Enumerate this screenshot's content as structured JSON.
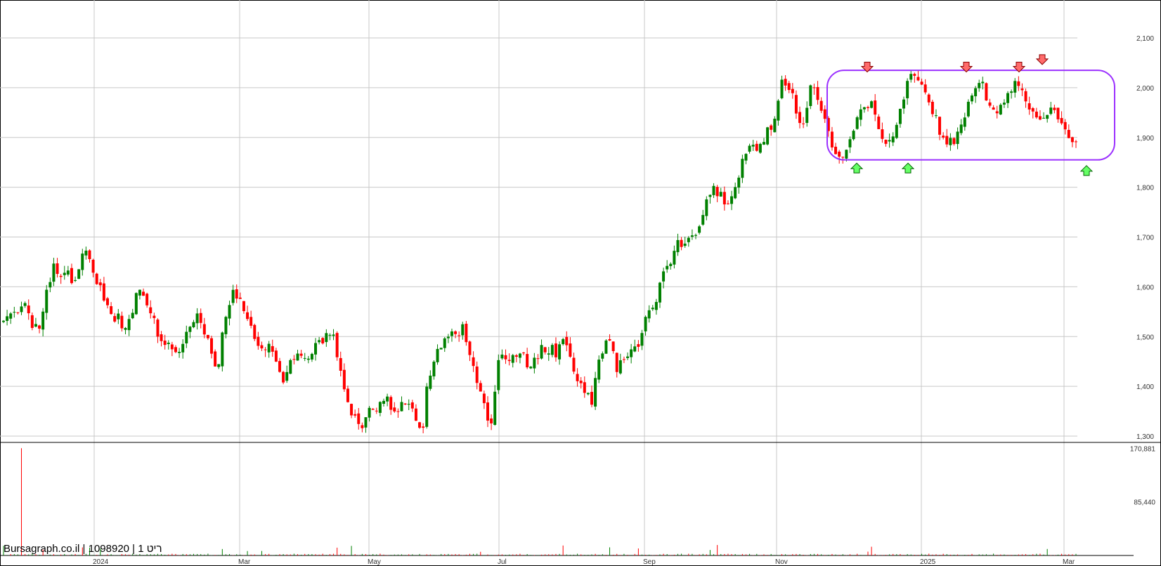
{
  "chart_data": {
    "type": "candlestick",
    "watermark": "Bursagraph.co.il | 1098920 | 1 ריט",
    "price_axis": {
      "ticks": [
        1300,
        1400,
        1500,
        1600,
        1700,
        1800,
        1900,
        2000,
        2100
      ],
      "tick_labels": [
        "1,300",
        "1,400",
        "1,500",
        "1,600",
        "1,700",
        "1,800",
        "1,900",
        "2,000",
        "2,100"
      ],
      "ylim": [
        1286,
        2175
      ]
    },
    "volume_axis": {
      "tick_labels": [
        "170,881",
        "85,440"
      ],
      "ticks": [
        170881,
        85440
      ],
      "ylim": [
        0,
        179000
      ]
    },
    "x_axis": {
      "labels": [
        "2024",
        "Mar",
        "May",
        "Jul",
        "Sep",
        "Nov",
        "2025",
        "Mar"
      ]
    },
    "grid": true,
    "colors": {
      "up": "#008000",
      "down": "#ff0000",
      "grid": "#c8c8c8",
      "annotation": "#9b30ff"
    },
    "price_path": [
      [
        1530,
        1550
      ],
      [
        1540,
        1545
      ],
      [
        1570,
        1540
      ],
      [
        1520,
        1512
      ],
      [
        1560,
        1600
      ],
      [
        1650,
        1630
      ],
      [
        1625,
        1625
      ],
      [
        1590,
        1640
      ],
      [
        1670,
        1675
      ],
      [
        1620,
        1610
      ],
      [
        1580,
        1570
      ],
      [
        1520,
        1540
      ],
      [
        1500,
        1525
      ],
      [
        1560,
        1610
      ],
      [
        1580,
        1560
      ],
      [
        1540,
        1500
      ],
      [
        1475,
        1495
      ],
      [
        1470,
        1465
      ],
      [
        1490,
        1510
      ],
      [
        1530,
        1545
      ],
      [
        1510,
        1495
      ],
      [
        1460,
        1430
      ],
      [
        1520,
        1555
      ],
      [
        1595,
        1580
      ],
      [
        1560,
        1540
      ],
      [
        1500,
        1480
      ],
      [
        1465,
        1490
      ],
      [
        1470,
        1435
      ],
      [
        1410,
        1440
      ],
      [
        1460,
        1470
      ],
      [
        1450,
        1455
      ],
      [
        1470,
        1500
      ],
      [
        1490,
        1505
      ],
      [
        1510,
        1460
      ],
      [
        1400,
        1370
      ],
      [
        1340,
        1330
      ],
      [
        1320,
        1350
      ],
      [
        1355,
        1360
      ],
      [
        1380,
        1370
      ],
      [
        1350,
        1345
      ],
      [
        1365,
        1355
      ],
      [
        1360,
        1325
      ],
      [
        1305,
        1410
      ],
      [
        1430,
        1470
      ],
      [
        1480,
        1500
      ],
      [
        1510,
        1490
      ],
      [
        1530,
        1470
      ],
      [
        1440,
        1410
      ],
      [
        1385,
        1340
      ],
      [
        1330,
        1440
      ],
      [
        1470,
        1445
      ],
      [
        1470,
        1455
      ],
      [
        1470,
        1430
      ],
      [
        1450,
        1460
      ],
      [
        1480,
        1465
      ],
      [
        1480,
        1460
      ],
      [
        1500,
        1485
      ],
      [
        1440,
        1410
      ],
      [
        1395,
        1380
      ],
      [
        1370,
        1440
      ],
      [
        1470,
        1495
      ],
      [
        1480,
        1435
      ],
      [
        1450,
        1460
      ],
      [
        1470,
        1480
      ],
      [
        1500,
        1560
      ],
      [
        1560,
        1580
      ],
      [
        1620,
        1640
      ],
      [
        1660,
        1690
      ],
      [
        1680,
        1700
      ],
      [
        1710,
        1700
      ],
      [
        1740,
        1775
      ],
      [
        1800,
        1790
      ],
      [
        1780,
        1765
      ],
      [
        1790,
        1800
      ],
      [
        1850,
        1880
      ],
      [
        1900,
        1880
      ],
      [
        1890,
        1910
      ],
      [
        1920,
        1960
      ],
      [
        2020,
        2000
      ],
      [
        1990,
        1940
      ],
      [
        1920,
        1960
      ],
      [
        2010,
        1980
      ],
      [
        1960,
        1920
      ],
      [
        1890,
        1870
      ],
      [
        1860,
        1880
      ],
      [
        1900,
        1930
      ],
      [
        1960,
        1950
      ],
      [
        1980,
        1930
      ],
      [
        1900,
        1880
      ],
      [
        1890,
        1920
      ],
      [
        1960,
        2000
      ],
      [
        2030,
        2010
      ],
      [
        2000,
        1980
      ],
      [
        1960,
        1940
      ],
      [
        1900,
        1895
      ],
      [
        1890,
        1900
      ],
      [
        1920,
        1960
      ],
      [
        1990,
        2000
      ],
      [
        2030,
        1980
      ],
      [
        1960,
        1940
      ],
      [
        1960,
        1980
      ],
      [
        1990,
        2020
      ],
      [
        2000,
        1970
      ],
      [
        1960,
        1950
      ],
      [
        1940,
        1945
      ],
      [
        1960,
        1940
      ],
      [
        1930,
        1905
      ],
      [
        1880,
        1890
      ]
    ],
    "annotations": {
      "box_price_range": [
        1855,
        2035
      ],
      "resistance_peak_prices": [
        2040,
        2040,
        2040,
        2055
      ],
      "support_trough_prices": [
        1840,
        1840,
        1835
      ]
    }
  }
}
